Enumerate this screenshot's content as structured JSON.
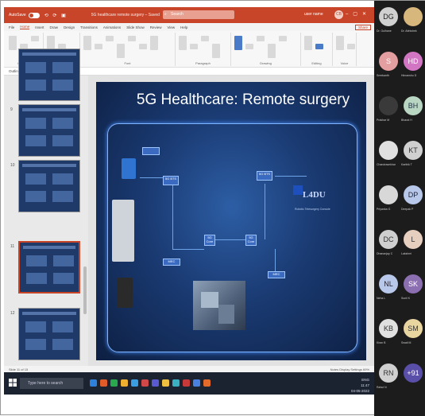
{
  "titlebar": {
    "autosave": "AutoSave",
    "doc_title": "5G healthcare remote surgery – Saved",
    "search_placeholder": "Search",
    "user": "user name",
    "user_initials": "CB"
  },
  "tabs": [
    "File",
    "Home",
    "Insert",
    "Draw",
    "Design",
    "Transitions",
    "Animations",
    "Slide Show",
    "Review",
    "View",
    "Help"
  ],
  "share_label": "Share",
  "ribbon": {
    "groups": [
      "Clipboard",
      "Slides",
      "Font",
      "Paragraph",
      "Drawing",
      "Editing",
      "Voice"
    ]
  },
  "formula": {
    "text": "Outline  |  Normal"
  },
  "thumbnails": [
    {
      "num": "",
      "title": "Remote Surgery"
    },
    {
      "num": "9",
      "title": "5G Architecture"
    },
    {
      "num": "10",
      "title": "5G Network"
    },
    {
      "num": "11",
      "title": "5G Healthcare: Remote surgery",
      "selected": true
    },
    {
      "num": "12",
      "title": "5G Healthcare: Remote monitoring"
    }
  ],
  "slide": {
    "title": "5G Healthcare: Remote surgery",
    "nodes": [
      "5G BTS",
      "5G BTS",
      "5G Core",
      "5G Core",
      "MEC",
      "MEC"
    ],
    "caption": "Robotic Telesurgery Console",
    "logo_text": "L4DU"
  },
  "statusbar": {
    "left": "Slide 11 of 15",
    "right": "Notes  Display Settings  69%"
  },
  "taskbar": {
    "search_placeholder": "Type here to search",
    "tray": [
      "ENG",
      "11:47",
      "04-05-2022"
    ],
    "icon_colors": [
      "#2e80d8",
      "#e25c2a",
      "#2aa84e",
      "#f0b030",
      "#3a9ee0",
      "#d04848",
      "#5a5ad0",
      "#f0c040",
      "#3ab0c0",
      "#c83a3a",
      "#4a80e0",
      "#e26a2a"
    ]
  },
  "participants": [
    {
      "initials": "DG",
      "name": "Dr. Gulhane",
      "color": "#d0d0d0",
      "text": "#222"
    },
    {
      "initials": "",
      "name": "Dr. Abhishek",
      "color": "#d8b77c",
      "text": "#222"
    },
    {
      "initials": "S",
      "name": "Sreekanth",
      "color": "#e39ea0",
      "text": "#fff"
    },
    {
      "initials": "HD",
      "name": "Himanshu D",
      "color": "#d276c4",
      "text": "#fff"
    },
    {
      "initials": "",
      "name": "Prakhar M",
      "color": "#3a3a3a",
      "text": "#fff"
    },
    {
      "initials": "BH",
      "name": "Bharat H",
      "color": "#b8d6c2",
      "text": "#234"
    },
    {
      "initials": "",
      "name": "Chandrasekhar",
      "color": "#e0e0e0",
      "text": "#222"
    },
    {
      "initials": "KT",
      "name": "Karthik T",
      "color": "#d0d0d0",
      "text": "#333"
    },
    {
      "initials": "",
      "name": "Priyanka G",
      "color": "#d8d8d8",
      "text": "#222"
    },
    {
      "initials": "DP",
      "name": "Deepak P",
      "color": "#b8c8ea",
      "text": "#223"
    },
    {
      "initials": "DC",
      "name": "Dhananjay C",
      "color": "#cfcfcf",
      "text": "#333"
    },
    {
      "initials": "L",
      "name": "Lakshmi",
      "color": "#e7cfc0",
      "text": "#333"
    },
    {
      "initials": "NL",
      "name": "Neha L",
      "color": "#b8c8ea",
      "text": "#223"
    },
    {
      "initials": "SK",
      "name": "Sunil K",
      "color": "#8c6fb0",
      "text": "#fff"
    },
    {
      "initials": "KB",
      "name": "Kiran B",
      "color": "#e0e0e0",
      "text": "#333"
    },
    {
      "initials": "SM",
      "name": "Swati M",
      "color": "#e8d5a0",
      "text": "#333"
    },
    {
      "initials": "RN",
      "name": "Rahul N",
      "color": "#d0d0d0",
      "text": "#333"
    },
    {
      "initials": "+91",
      "name": "",
      "color": "#5a4fa8",
      "text": "#fff"
    }
  ]
}
